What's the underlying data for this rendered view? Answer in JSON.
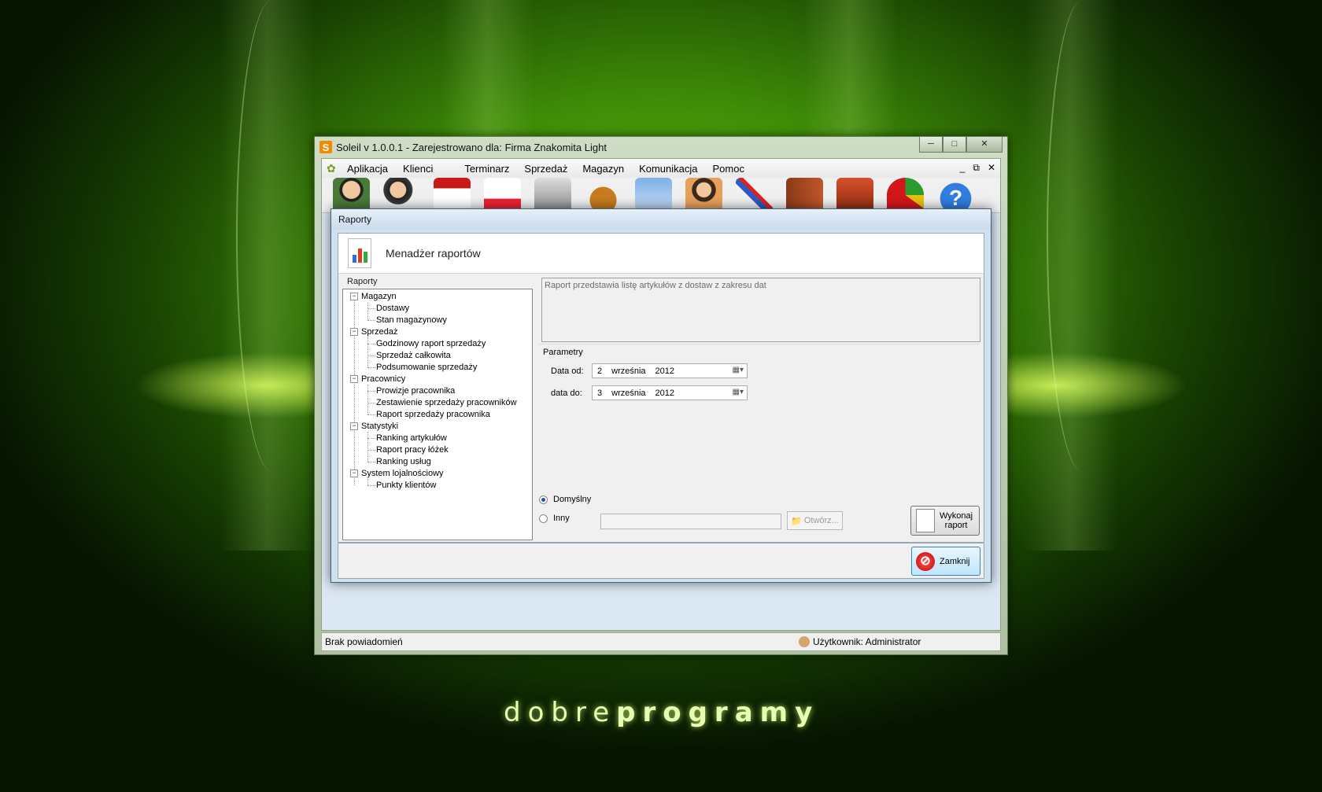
{
  "window": {
    "title": "Soleil v 1.0.0.1 - Zarejestrowano dla: Firma Znakomita Light",
    "logo_letter": "S"
  },
  "menubar": {
    "items": [
      "Aplikacja",
      "Klienci",
      "Terminarz",
      "Sprzedaż",
      "Magazyn",
      "Komunikacja",
      "Pomoc"
    ]
  },
  "toolbar": {
    "icons": [
      "client-icon",
      "clients-icon",
      "calendar-icon",
      "schedule-icon",
      "cash-register-icon",
      "money-bag-icon",
      "id-card-icon",
      "employee-icon",
      "tools-icon",
      "warehouse-icon",
      "boxes-icon",
      "pie-chart-icon",
      "help-icon"
    ]
  },
  "statusbar": {
    "left": "Brak powiadomień",
    "user": "Użytkownik: Administrator"
  },
  "dialog": {
    "title": "Raporty",
    "heading": "Menadżer raportów",
    "tree_label": "Raporty",
    "tree": [
      {
        "label": "Magazyn",
        "children": [
          "Dostawy",
          "Stan magazynowy"
        ]
      },
      {
        "label": "Sprzedaż",
        "children": [
          "Godzinowy raport sprzedaży",
          "Sprzedaż całkowita",
          "Podsumowanie sprzedaży"
        ]
      },
      {
        "label": "Pracownicy",
        "children": [
          "Prowizje pracownika",
          "Zestawienie sprzedaży pracowników",
          "Raport sprzedaży pracownika"
        ]
      },
      {
        "label": "Statystyki",
        "children": [
          "Ranking artykułów",
          "Raport pracy łóżek",
          "Ranking usług"
        ]
      },
      {
        "label": "System lojalnościowy",
        "children": [
          "Punkty klientów"
        ]
      }
    ],
    "description": "Raport przedstawia listę artykułów z dostaw z zakresu dat",
    "params_label": "Parametry",
    "date_from": {
      "label": "Data od:",
      "day": "2",
      "month": "września",
      "year": "2012"
    },
    "date_to": {
      "label": "data do:",
      "day": "3",
      "month": "września",
      "year": "2012"
    },
    "radio_default": "Domyślny",
    "radio_other": "Inny",
    "path_value": "",
    "open_button": "Otwórz...",
    "run_button_line1": "Wykonaj",
    "run_button_line2": "raport",
    "close_button": "Zamknij"
  },
  "branding": {
    "part1": "dobre",
    "part2": "programy"
  },
  "colors": {
    "background_green": "#3d8a07",
    "close_button_red": "#c40000"
  }
}
